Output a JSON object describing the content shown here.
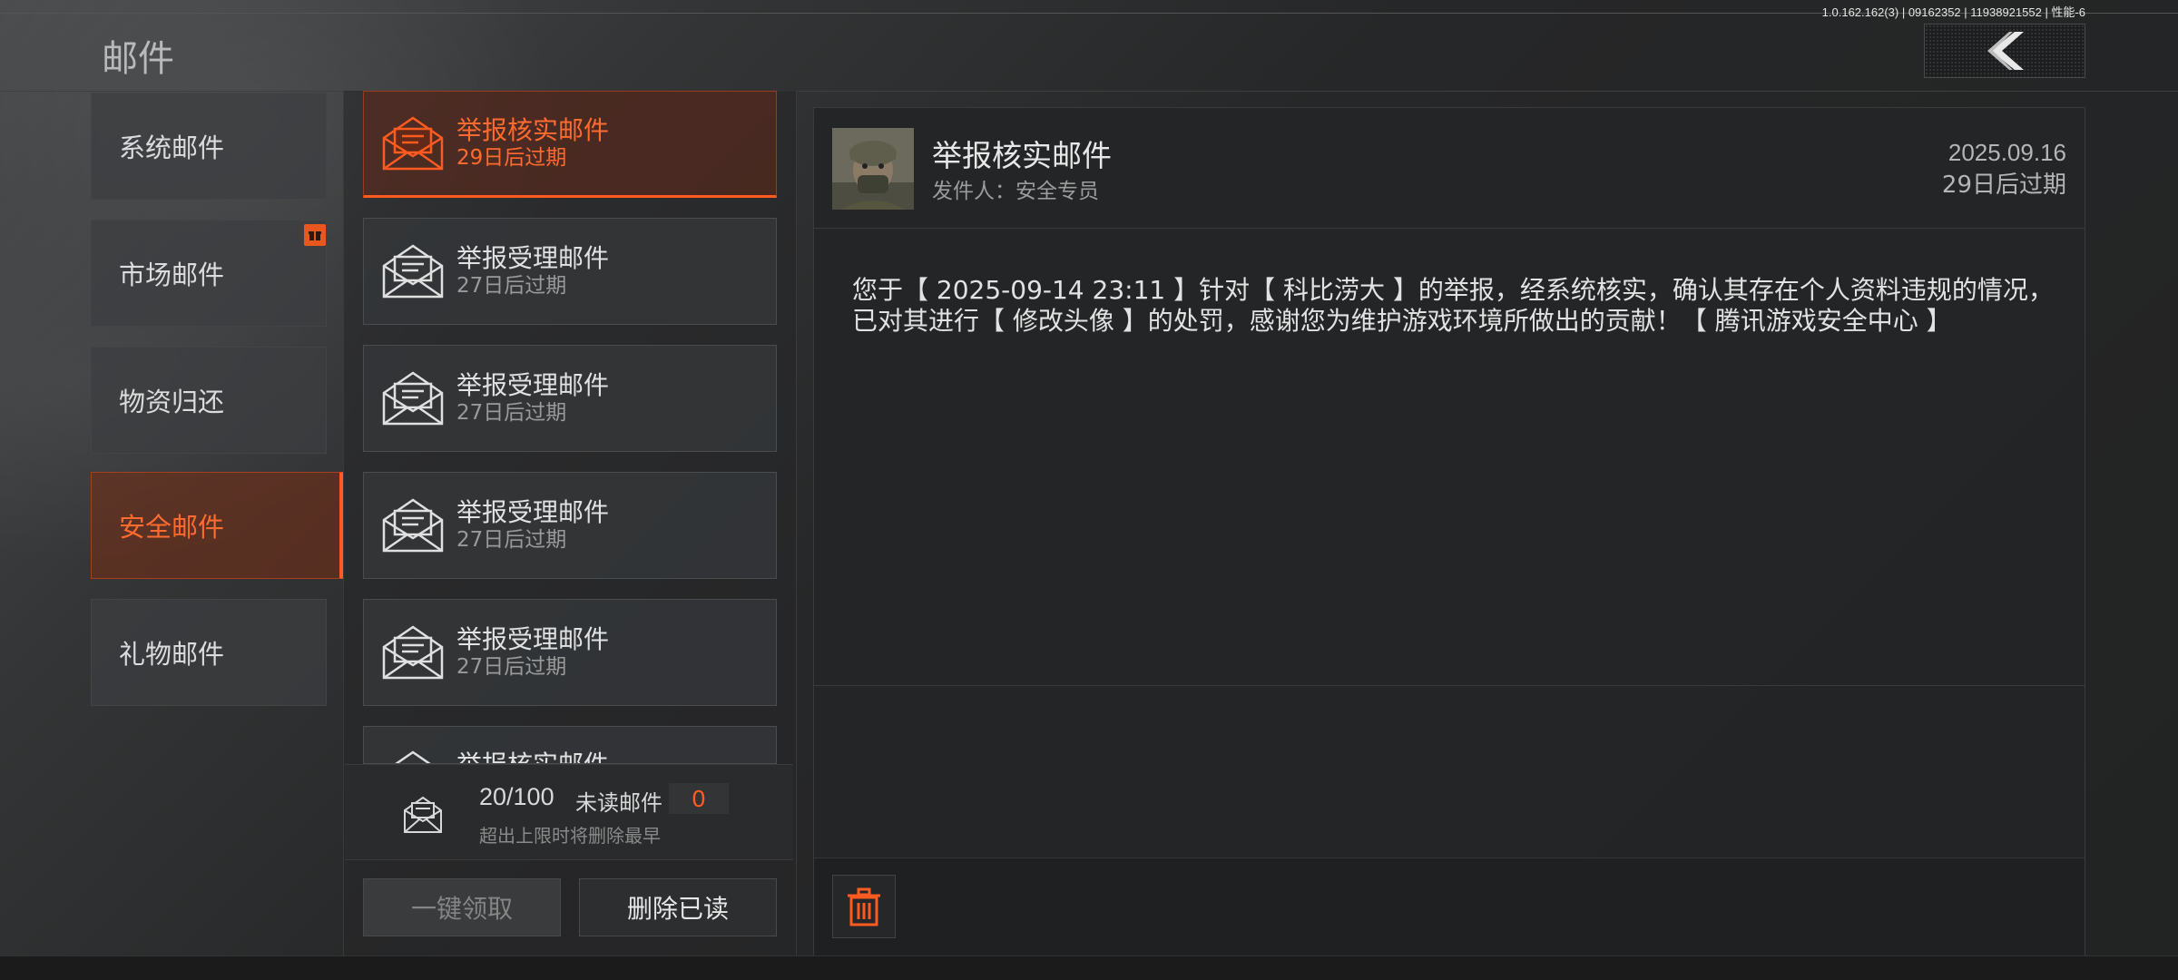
{
  "app": {
    "version": "1.0.162.162(3) | 09162352 | 11938921552 | 性能-6",
    "title": "邮件"
  },
  "colors": {
    "accent": "#ff5a1f",
    "background": "#262728"
  },
  "categories": [
    {
      "label": "系统邮件",
      "active": false
    },
    {
      "label": "市场邮件",
      "active": false,
      "badge": "gift-icon"
    },
    {
      "label": "物资归还",
      "active": false
    },
    {
      "label": "安全邮件",
      "active": true
    },
    {
      "label": "礼物邮件",
      "active": false
    }
  ],
  "mails": [
    {
      "title": "举报核实邮件",
      "expire": "29日后过期",
      "active": true
    },
    {
      "title": "举报受理邮件",
      "expire": "27日后过期",
      "active": false
    },
    {
      "title": "举报受理邮件",
      "expire": "27日后过期",
      "active": false
    },
    {
      "title": "举报受理邮件",
      "expire": "27日后过期",
      "active": false
    },
    {
      "title": "举报受理邮件",
      "expire": "27日后过期",
      "active": false
    },
    {
      "title": "举报核实邮件",
      "expire": "",
      "active": false
    }
  ],
  "stats": {
    "count": "20/100",
    "unread_label": "未读邮件",
    "unread_count": "0",
    "note": "超出上限时将删除最早"
  },
  "buttons": {
    "claim_all": "一键领取",
    "delete_read": "删除已读"
  },
  "detail": {
    "title": "举报核实邮件",
    "sender": "发件人：安全专员",
    "date": "2025.09.16",
    "expire": "29日后过期",
    "body_line1": "您于【 2025-09-14 23:11 】针对【 科比涝大 】的举报，经系统核实，确认其存在个人资料违规的情况，",
    "body_line2": "已对其进行【 修改头像 】的处罚，感谢您为维护游戏环境所做出的贡献！【 腾讯游戏安全中心 】"
  }
}
